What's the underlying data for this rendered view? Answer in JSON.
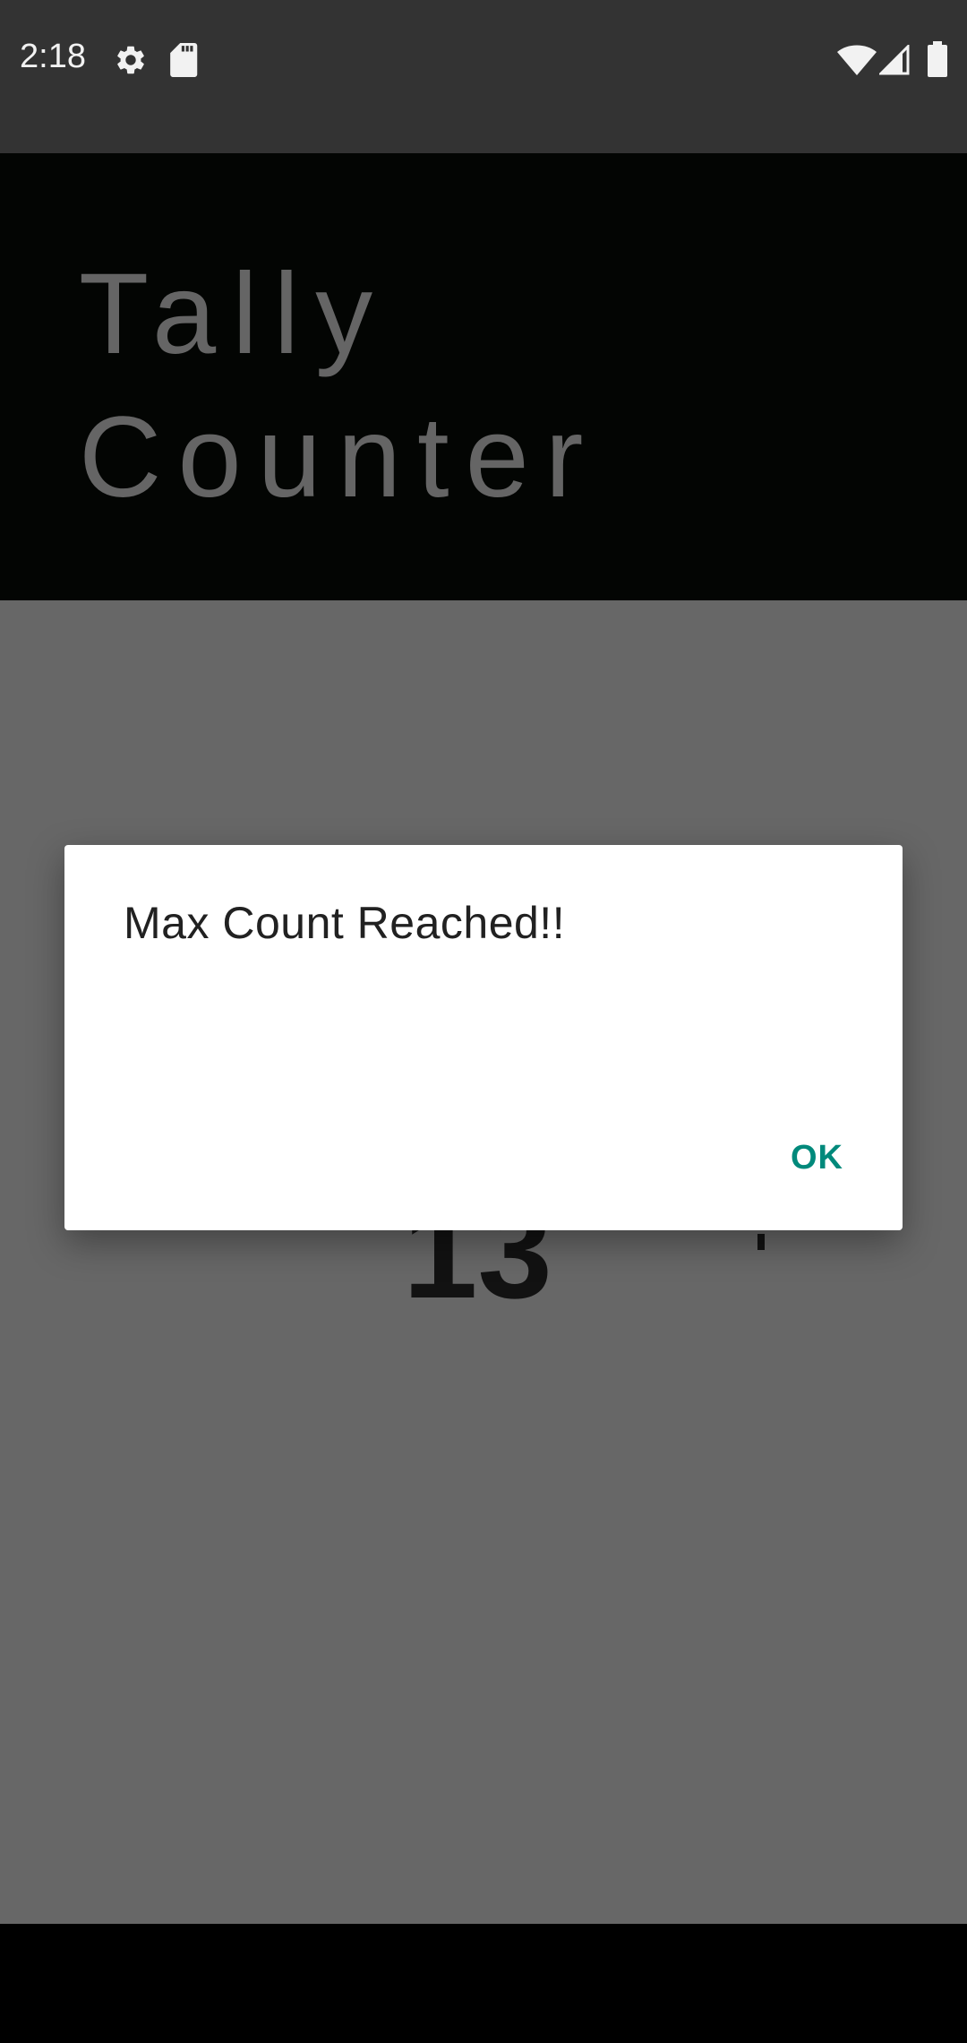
{
  "status_bar": {
    "time": "2:18",
    "left_icons": [
      "gear-icon",
      "sd-card-icon"
    ],
    "right_icons": [
      "wifi-icon",
      "signal-icon",
      "battery-icon"
    ]
  },
  "app_bar": {
    "title": "Tally\nCounter"
  },
  "counter": {
    "count_partial": "13"
  },
  "dialog": {
    "title": "Max Count Reached!!",
    "ok_label": "OK"
  },
  "colors": {
    "status_bar_bg": "#333333",
    "app_bar_bg": "#030503",
    "scrim_bg": "#676767",
    "dialog_bg": "#ffffff",
    "accent": "#00897b"
  }
}
